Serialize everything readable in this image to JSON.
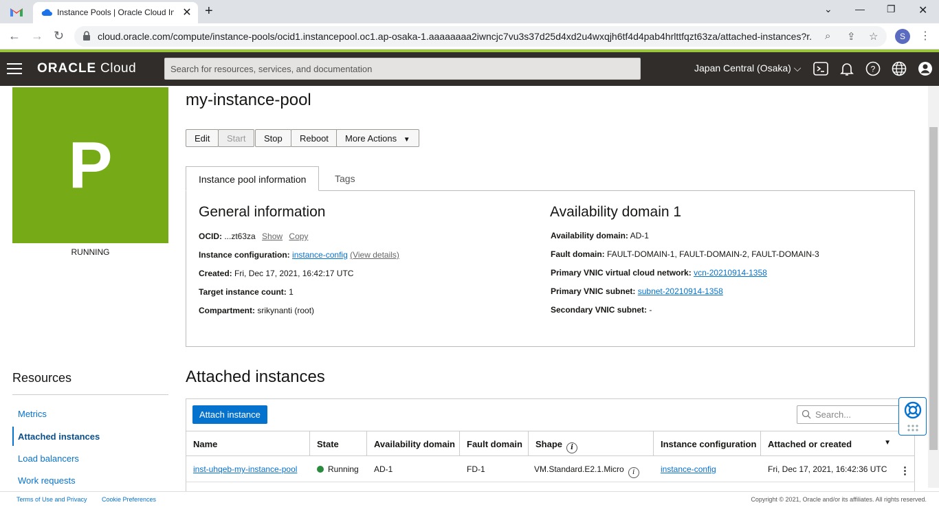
{
  "browser": {
    "tab_title": "Instance Pools | Oracle Cloud Infr",
    "url": "cloud.oracle.com/compute/instance-pools/ocid1.instancepool.oc1.ap-osaka-1.aaaaaaaa2iwncjc7vu3s37d25d4xd2u4wxqjh6tf4d4pab4hrlttfqzt63za/attached-instances?r...",
    "avatar_letter": "S"
  },
  "header": {
    "logo_brand": "ORACLE",
    "logo_product": " Cloud",
    "search_placeholder": "Search for resources, services, and documentation",
    "region": "Japan Central (Osaka)"
  },
  "tile": {
    "letter": "P",
    "state": "RUNNING",
    "color": "#76ab17"
  },
  "resources": {
    "title": "Resources",
    "items": [
      {
        "label": "Metrics"
      },
      {
        "label": "Attached instances"
      },
      {
        "label": "Load balancers"
      },
      {
        "label": "Work requests"
      }
    ]
  },
  "page": {
    "title": "my-instance-pool",
    "buttons": {
      "edit": "Edit",
      "start": "Start",
      "stop": "Stop",
      "reboot": "Reboot",
      "more": "More Actions"
    },
    "tabs": {
      "info": "Instance pool information",
      "tags": "Tags"
    }
  },
  "general": {
    "title": "General information",
    "ocid_label": "OCID:",
    "ocid_value": "...zt63za",
    "show": "Show",
    "copy": "Copy",
    "config_label": "Instance configuration:",
    "config_value": "instance-config",
    "view_details": "(View details)",
    "created_label": "Created:",
    "created_value": "Fri, Dec 17, 2021, 16:42:17 UTC",
    "target_label": "Target instance count:",
    "target_value": "1",
    "compartment_label": "Compartment:",
    "compartment_value": "srikynanti (root)"
  },
  "availability": {
    "title": "Availability domain 1",
    "ad_label": "Availability domain:",
    "ad_value": "AD-1",
    "fd_label": "Fault domain:",
    "fd_value": "FAULT-DOMAIN-1, FAULT-DOMAIN-2, FAULT-DOMAIN-3",
    "vcn_label": "Primary VNIC virtual cloud network:",
    "vcn_value": "vcn-20210914-1358",
    "subnet_label": "Primary VNIC subnet:",
    "subnet_value": "subnet-20210914-1358",
    "secondary_label": "Secondary VNIC subnet:",
    "secondary_value": "-"
  },
  "attached": {
    "title": "Attached instances",
    "attach_button": "Attach instance",
    "search_placeholder": "Search...",
    "columns": {
      "name": "Name",
      "state": "State",
      "ad": "Availability domain",
      "fd": "Fault domain",
      "shape": "Shape",
      "config": "Instance configuration",
      "created": "Attached or created"
    },
    "rows": [
      {
        "name": "inst-uhqeb-my-instance-pool",
        "state": "Running",
        "ad": "AD-1",
        "fd": "FD-1",
        "shape": "VM.Standard.E2.1.Micro",
        "config": "instance-config",
        "created": "Fri, Dec 17, 2021, 16:42:36 UTC"
      }
    ]
  },
  "footer": {
    "terms": "Terms of Use and Privacy",
    "cookies": "Cookie Preferences",
    "copyright": "Copyright © 2021, Oracle and/or its affiliates. All rights reserved."
  }
}
